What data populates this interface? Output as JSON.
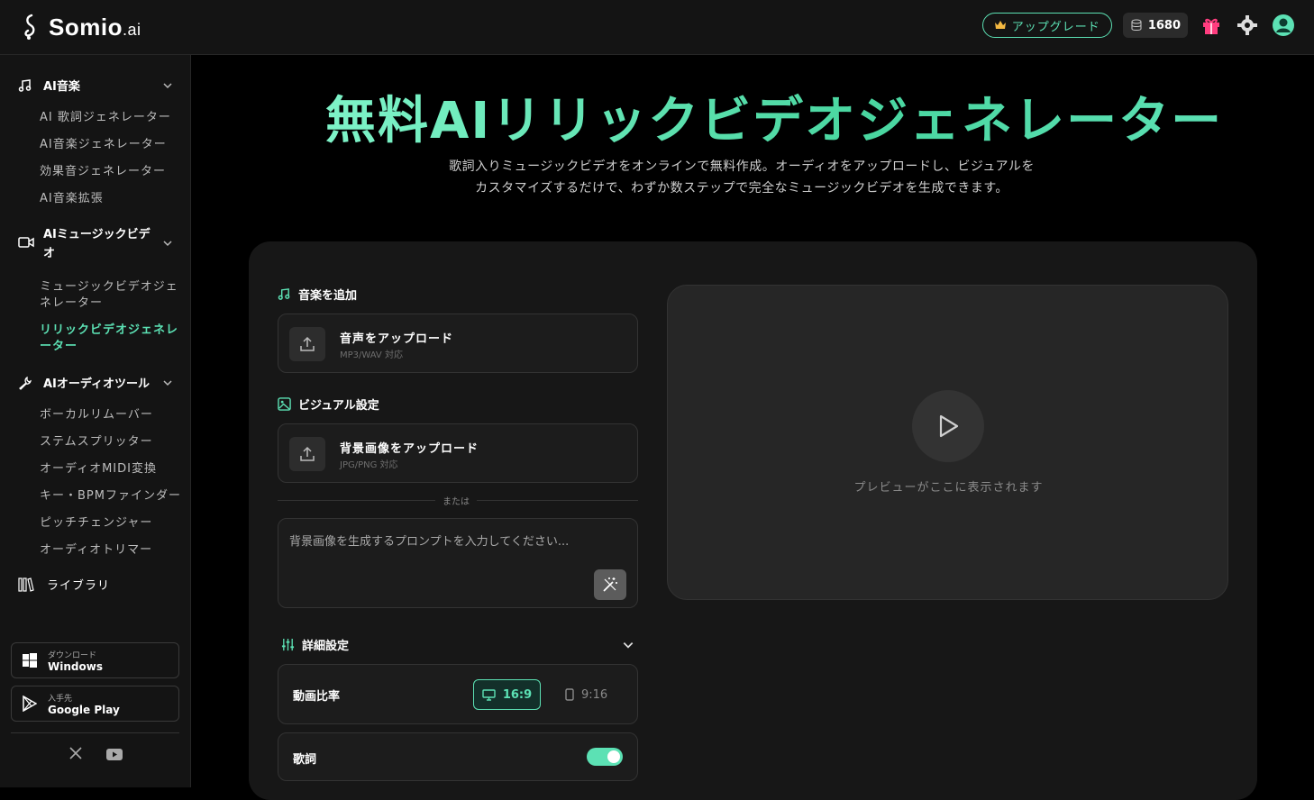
{
  "app": {
    "logo_main": "Somio",
    "logo_suffix": ".ai"
  },
  "topbar": {
    "upgrade_label": "アップグレード",
    "credits": "1680"
  },
  "sidebar": {
    "sections": [
      {
        "label": "AI音楽",
        "items": [
          "AI 歌詞ジェネレーター",
          "AI音楽ジェネレーター",
          "効果音ジェネレーター",
          "AI音楽拡張"
        ]
      },
      {
        "label": "AIミュージックビデオ",
        "items": [
          "ミュージックビデオジェネレーター",
          "リリックビデオジェネレーター"
        ]
      },
      {
        "label": "AIオーディオツール",
        "items": [
          "ボーカルリムーバー",
          "ステムスプリッター",
          "オーディオMIDI変換",
          "キー・BPMファインダー",
          "ピッチチェンジャー",
          "オーディオトリマー"
        ]
      }
    ],
    "library_label": "ライブラリ",
    "downloads": [
      {
        "small": "ダウンロード",
        "big": "Windows"
      },
      {
        "small": "入手先",
        "big": "Google Play"
      }
    ]
  },
  "main": {
    "title": "無料AIリリックビデオジェネレーター",
    "description_line1": "歌詞入りミュージックビデオをオンラインで無料作成。オーディオをアップロードし、ビジュアルを",
    "description_line2": "カスタマイズするだけで、わずか数ステップで完全なミュージックビデオを生成できます。",
    "add_music_label": "音楽を追加",
    "audio_upload_title": "音声をアップロード",
    "audio_upload_sub": "MP3/WAV 対応",
    "visual_label": "ビジュアル設定",
    "image_upload_title": "背景画像をアップロード",
    "image_upload_sub": "JPG/PNG 対応",
    "or_label": "または",
    "prompt_placeholder": "背景画像を生成するプロンプトを入力してください...",
    "advanced_label": "詳細設定",
    "ratio_label": "動画比率",
    "ratio_active": "16:9",
    "ratio_other": "9:16",
    "lyrics_label": "歌詞",
    "lyrics_enabled": true,
    "preview_text": "プレビューがここに表示されます"
  },
  "colors": {
    "accent": "#5ce1b4",
    "background": "#000000",
    "panel": "#171717"
  }
}
